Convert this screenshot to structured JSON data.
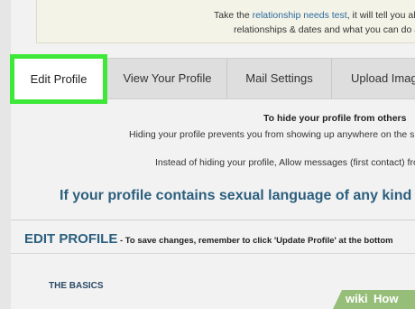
{
  "notice": {
    "line1_pre": "Take the ",
    "line1_link": "relationship needs test",
    "line1_post": ", it will tell you all",
    "line2": "relationships & dates and what you can do a"
  },
  "tabs": [
    {
      "label": "Edit Profile",
      "active": true
    },
    {
      "label": "View Your Profile",
      "active": false
    },
    {
      "label": "Mail Settings",
      "active": false
    },
    {
      "label": "Upload Imag",
      "active": false
    }
  ],
  "hide_info": {
    "heading": "To hide your profile from others",
    "line1": "Hiding your profile prevents you from showing up anywhere on the site",
    "line2": "Instead of hiding your profile, Allow messages (first contact) from"
  },
  "warning": "If your profile contains sexual language of any kind",
  "edit_profile": {
    "heading": "EDIT PROFILE",
    "instruction": " - To save changes, remember to click 'Update Profile' at the bottom"
  },
  "section": {
    "title": "THE BASICS"
  },
  "watermark": {
    "wiki": "wiki",
    "how": "How"
  },
  "colors": {
    "active_tab_highlight": "#3ee838",
    "heading_blue": "#2c5f7e",
    "link_blue": "#2e6a9c",
    "watermark_green": "#96be78"
  }
}
